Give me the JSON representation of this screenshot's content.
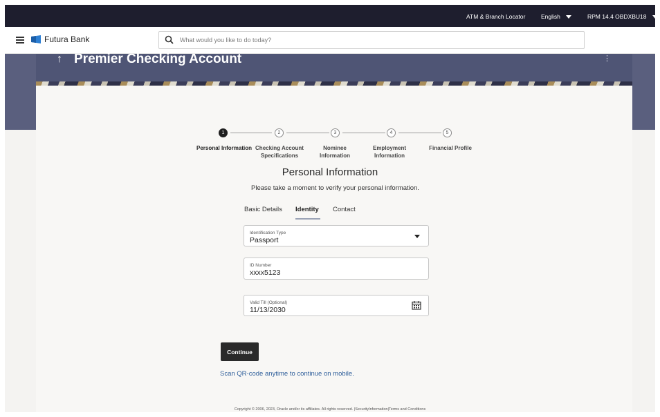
{
  "topbar": {
    "atm_label": "ATM & Branch Locator",
    "language": "English",
    "user": "RPM 14.4 OBDXBU18"
  },
  "header": {
    "bank_name": "Futura Bank",
    "search_placeholder": "What would you like to do today?"
  },
  "page": {
    "title": "Premier Checking Account"
  },
  "stepper": [
    {
      "num": "1",
      "label": "Personal Information",
      "active": true
    },
    {
      "num": "2",
      "label": "Checking Account Specifications",
      "active": false
    },
    {
      "num": "3",
      "label": "Nominee Information",
      "active": false
    },
    {
      "num": "4",
      "label": "Employment Information",
      "active": false
    },
    {
      "num": "5",
      "label": "Financial Profile",
      "active": false
    }
  ],
  "section": {
    "title": "Personal Information",
    "subtitle": "Please take a moment to verify your personal information."
  },
  "tabs": [
    "Basic Details",
    "Identity",
    "Contact"
  ],
  "active_tab": "Identity",
  "form": {
    "id_type": {
      "label": "Identification Type",
      "value": "Passport"
    },
    "id_number": {
      "label": "ID Number",
      "value": "xxxx5123"
    },
    "valid_till": {
      "label": "Valid Till (Optional)",
      "value": "11/13/2030"
    }
  },
  "actions": {
    "continue_label": "Continue",
    "qr_text": "Scan QR-code anytime to continue on mobile."
  },
  "footer": {
    "copyright": "Copyright © 2006, 2023, Oracle and/or its affiliates. All rights reserved.",
    "security_link": "SecurityInformation",
    "terms_link": "Terms and Conditions"
  },
  "colors": {
    "topbar": "#1e1e2e",
    "banner": "#5a5f7e",
    "button": "#2a2a2a",
    "link": "#2f5f9b"
  },
  "icons": [
    "menu-icon",
    "bank-logo-icon",
    "search-icon",
    "chevron-down-icon",
    "kebab-icon",
    "back-arrow-icon",
    "calendar-icon"
  ]
}
